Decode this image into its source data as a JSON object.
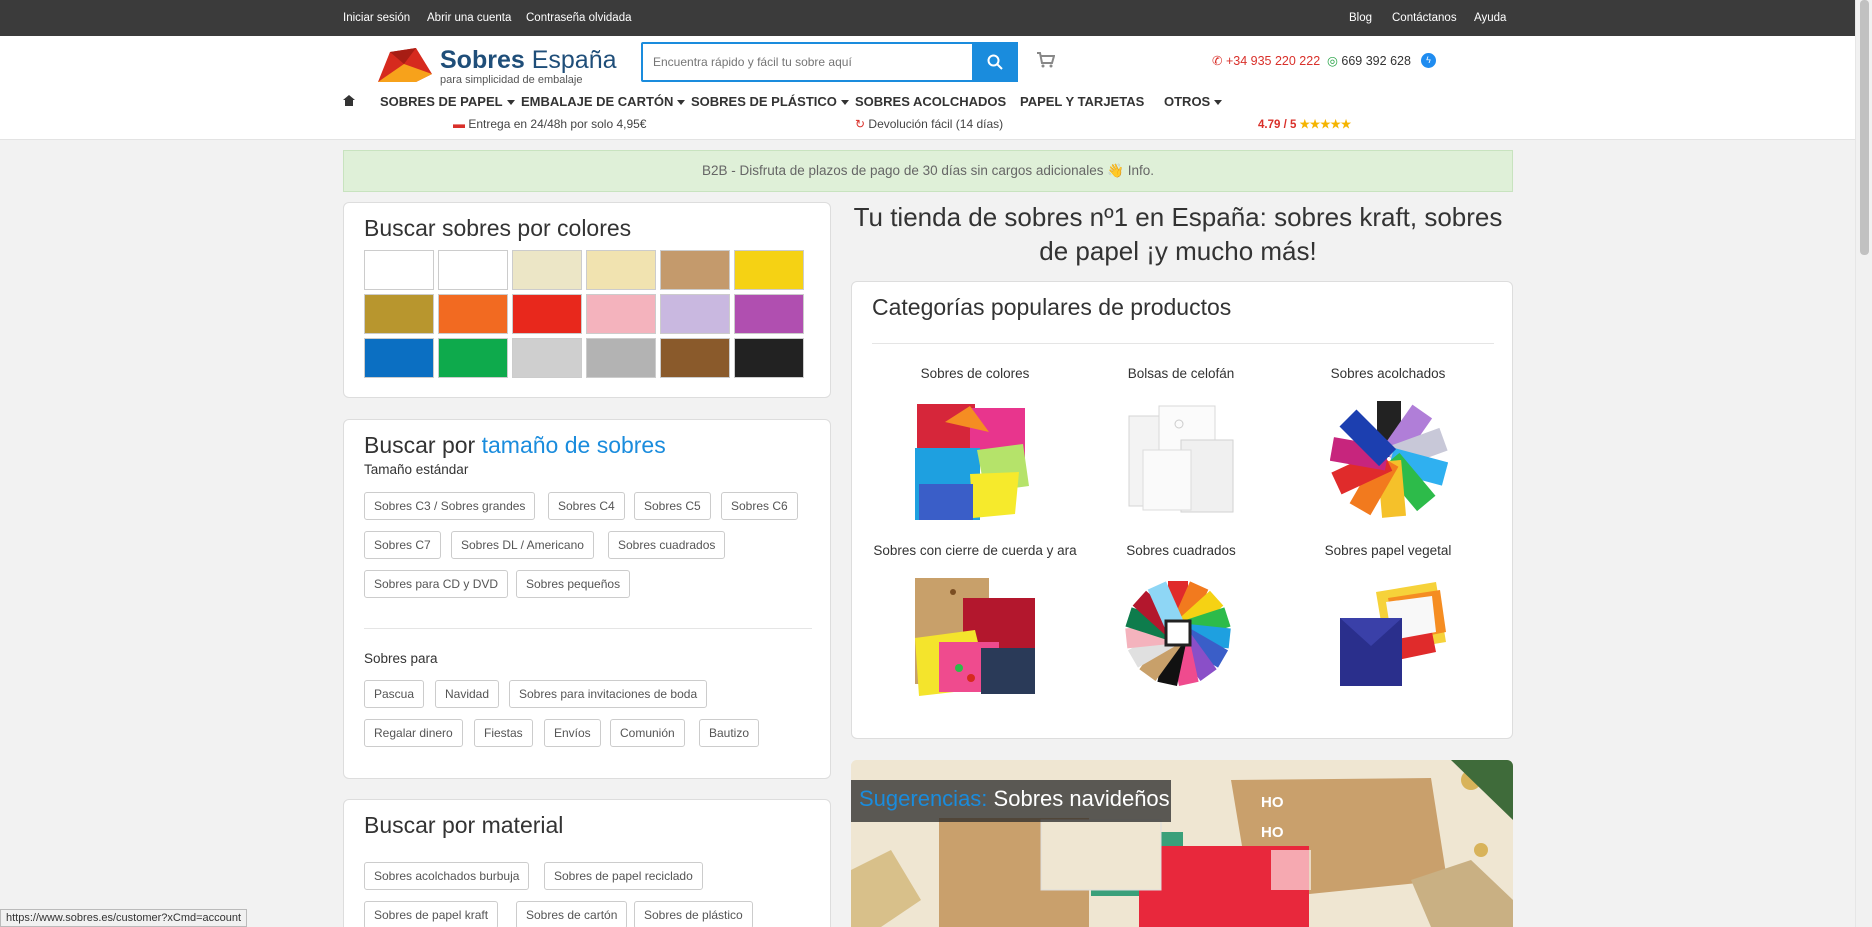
{
  "topbar": {
    "links_left": [
      "Iniciar sesión",
      "Abrir una cuenta",
      "Contraseña olvidada"
    ],
    "links_right": [
      "Blog",
      "Contáctanos",
      "Ayuda"
    ]
  },
  "logo": {
    "brand1": "Sobres",
    "brand2": "España",
    "tagline": "para simplicidad de embalaje"
  },
  "search": {
    "placeholder": "Encuentra rápido y fácil tu sobre aquí"
  },
  "contact": {
    "phone": "+34 935 220 222",
    "whatsapp": "669 392 628"
  },
  "nav": {
    "items": [
      "SOBRES DE PAPEL",
      "EMBALAJE DE CARTÓN",
      "SOBRES DE PLÁSTICO",
      "SOBRES ACOLCHADOS",
      "PAPEL Y TARJETAS",
      "OTROS"
    ]
  },
  "subinfo": {
    "delivery": "Entrega en 24/48h por solo 4,95€",
    "returns": "Devolución fácil (14 días)",
    "rating": "4.79 / 5",
    "stars": "★★★★★"
  },
  "banner": {
    "text": "B2B - Disfruta de plazos de pago de 30 días sin cargos adicionales 👋 Info."
  },
  "colors_panel": {
    "title": "Buscar sobres por colores",
    "swatches": [
      "#ffffff",
      "#ffffff",
      "#ece6c6",
      "#f1e3b0",
      "#c49a6c",
      "#f5d214",
      "#b8962e",
      "#f26a21",
      "#e8281c",
      "#f4b3bd",
      "#c9b8e0",
      "#b04fb0",
      "#0b6fc2",
      "#0eaa4c",
      "#cfcfcf",
      "#b3b3b3",
      "#8a5a2b",
      "#222222"
    ]
  },
  "size_panel": {
    "title_plain": "Buscar por",
    "title_link": "tamaño de sobres",
    "standard_label": "Tamaño estándar",
    "standard_tags": [
      "Sobres C3 / Sobres grandes",
      "Sobres C4",
      "Sobres C5",
      "Sobres C6",
      "Sobres C7",
      "Sobres DL / Americano",
      "Sobres cuadrados",
      "Sobres para CD y DVD",
      "Sobres pequeños"
    ],
    "for_label": "Sobres para",
    "for_tags": [
      "Pascua",
      "Navidad",
      "Sobres para invitaciones de boda",
      "Regalar dinero",
      "Fiestas",
      "Envíos",
      "Comunión",
      "Bautizo"
    ]
  },
  "material_panel": {
    "title": "Buscar por material",
    "tags": [
      "Sobres acolchados burbuja",
      "Sobres de papel reciclado",
      "Sobres de papel kraft",
      "Sobres de cartón",
      "Sobres de plástico"
    ]
  },
  "hero": {
    "line1": "Tu tienda de sobres nº1 en España: sobres kraft, sobres",
    "line2": "de papel ¡y mucho más!"
  },
  "categories": {
    "title": "Categorías populares de productos",
    "items": [
      "Sobres de colores",
      "Bolsas de celofán",
      "Sobres acolchados",
      "Sobres con cierre de cuerda y ara",
      "Sobres cuadrados",
      "Sobres papel vegetal"
    ]
  },
  "promo": {
    "label_blue": "Sugerencias:",
    "label_white": "Sobres navideños",
    "card_text1": "HO",
    "card_text2": "HO"
  },
  "status": {
    "url": "https://www.sobres.es/customer?xCmd=account"
  }
}
